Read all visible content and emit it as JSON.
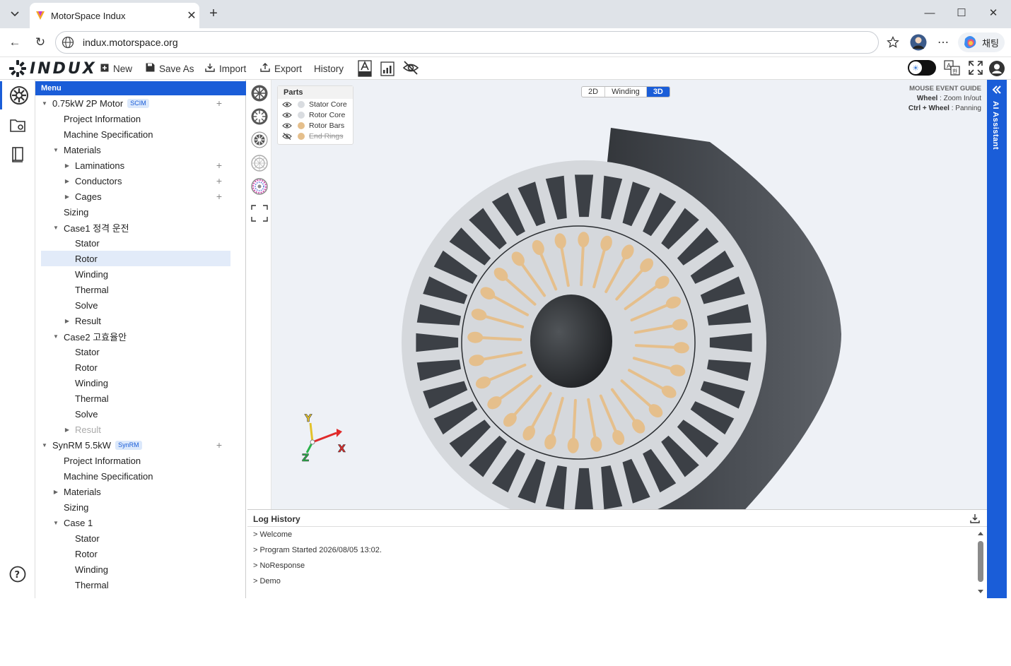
{
  "browser": {
    "tab_title": "MotorSpace Indux",
    "url": "indux.motorspace.org",
    "chat_label": "채팅"
  },
  "toolbar": {
    "logo_text": "INDUX",
    "new_label": "New",
    "save_as_label": "Save As",
    "import_label": "Import",
    "export_label": "Export",
    "history_label": "History"
  },
  "menu": {
    "title": "Menu",
    "items": [
      {
        "label": "0.75kW 2P Motor",
        "badge": "SCIM",
        "level": 0,
        "arrow": "down",
        "plus": true
      },
      {
        "label": "Project Information",
        "level": 1
      },
      {
        "label": "Machine Specification",
        "level": 1
      },
      {
        "label": "Materials",
        "level": 1,
        "arrow": "down"
      },
      {
        "label": "Laminations",
        "level": 2,
        "arrow": "right",
        "plus": true
      },
      {
        "label": "Conductors",
        "level": 2,
        "arrow": "right",
        "plus": true
      },
      {
        "label": "Cages",
        "level": 2,
        "arrow": "right",
        "plus": true
      },
      {
        "label": "Sizing",
        "level": 1
      },
      {
        "label": "Case1 정격 운전",
        "level": 1,
        "arrow": "down"
      },
      {
        "label": "Stator",
        "level": 2
      },
      {
        "label": "Rotor",
        "level": 2,
        "selected": true
      },
      {
        "label": "Winding",
        "level": 2
      },
      {
        "label": "Thermal",
        "level": 2
      },
      {
        "label": "Solve",
        "level": 2
      },
      {
        "label": "Result",
        "level": 2,
        "arrow": "right"
      },
      {
        "label": "Case2 고효율안",
        "level": 1,
        "arrow": "down"
      },
      {
        "label": "Stator",
        "level": 2
      },
      {
        "label": "Rotor",
        "level": 2
      },
      {
        "label": "Winding",
        "level": 2
      },
      {
        "label": "Thermal",
        "level": 2
      },
      {
        "label": "Solve",
        "level": 2
      },
      {
        "label": "Result",
        "level": 2,
        "arrow": "right",
        "dim": true
      },
      {
        "label": "SynRM 5.5kW",
        "badge": "SynRM",
        "level": 0,
        "arrow": "down",
        "plus": true
      },
      {
        "label": "Project Information",
        "level": 1
      },
      {
        "label": "Machine Specification",
        "level": 1
      },
      {
        "label": "Materials",
        "level": 1,
        "arrow": "right"
      },
      {
        "label": "Sizing",
        "level": 1
      },
      {
        "label": "Case 1",
        "level": 1,
        "arrow": "down"
      },
      {
        "label": "Stator",
        "level": 2
      },
      {
        "label": "Rotor",
        "level": 2
      },
      {
        "label": "Winding",
        "level": 2
      },
      {
        "label": "Thermal",
        "level": 2
      }
    ]
  },
  "viewer": {
    "view_modes": [
      "2D",
      "Winding",
      "3D"
    ],
    "active_mode": "3D",
    "parts_title": "Parts",
    "parts": [
      {
        "label": "Stator Core",
        "color": "#d9dce0",
        "visible": true
      },
      {
        "label": "Rotor Core",
        "color": "#d9dce0",
        "visible": true
      },
      {
        "label": "Rotor Bars",
        "color": "#e5bf8c",
        "visible": true
      },
      {
        "label": "End Rings",
        "color": "#e5bf8c",
        "visible": false
      }
    ],
    "guide_title": "MOUSE EVENT GUIDE",
    "guide_wheel_key": "Wheel",
    "guide_wheel_action": ": Zoom In/out",
    "guide_pan_key": "Ctrl + Wheel",
    "guide_pan_action": ": Panning",
    "axes": {
      "x": "X",
      "y": "Y",
      "z": "Z"
    }
  },
  "log": {
    "title": "Log History",
    "lines": [
      "> Welcome",
      "> Program Started  2026/08/05 13:02.",
      "> NoResponse",
      "> Demo"
    ]
  },
  "ai": {
    "label": "AI Assistant"
  },
  "colors": {
    "accent": "#1a5dd8",
    "stator": "#d5d8dc",
    "bar": "#e5bf8c",
    "slot": "#3c4046"
  }
}
